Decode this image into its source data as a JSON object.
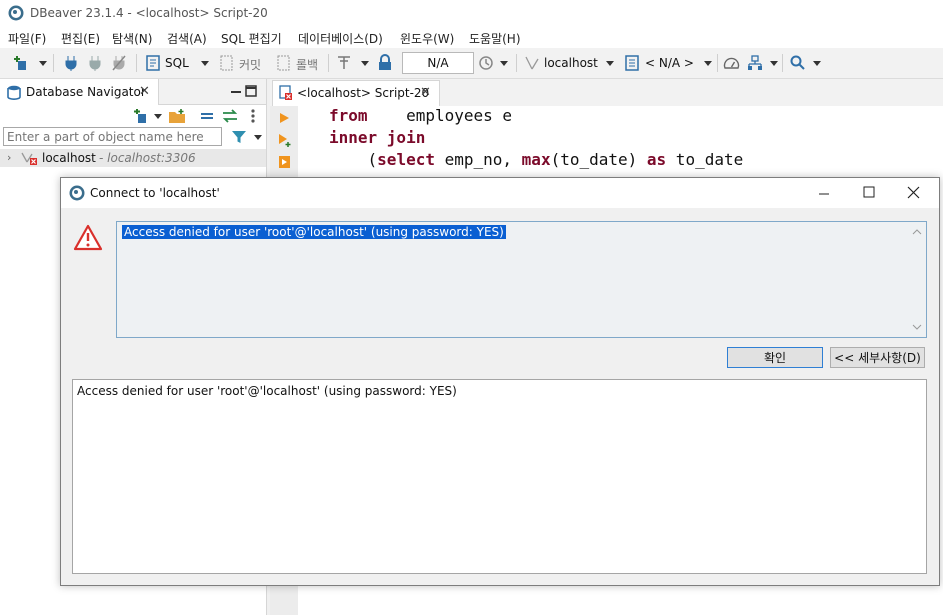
{
  "window": {
    "title": "DBeaver 23.1.4 - <localhost> Script-20"
  },
  "menu": [
    "파일(F)",
    "편집(E)",
    "탐색(N)",
    "검색(A)",
    "SQL 편집기",
    "데이터베이스(D)",
    "윈도우(W)",
    "도움말(H)"
  ],
  "toolbar": {
    "sql_label": "SQL",
    "commit_label": "커밋",
    "rollback_label": "롤백",
    "transaction_value": "N/A",
    "connection_label": "localhost",
    "schema_label": "< N/A >"
  },
  "navigator": {
    "tab_label": "Database Navigator",
    "filter_placeholder": "Enter a part of object name here",
    "tree": [
      {
        "label": "localhost",
        "detail": "- localhost:3306"
      }
    ]
  },
  "editor": {
    "tab_label": "<localhost> Script-20",
    "lines": [
      {
        "kw1": "from",
        "rest": "    employees e"
      },
      {
        "kw1": "inner join",
        "rest": ""
      },
      {
        "indent": "    (",
        "kw1": "select",
        "mid": " emp_no, ",
        "kw2": "max",
        "mid2": "(to_date) ",
        "kw3": "as",
        "tail": " to_date"
      }
    ]
  },
  "dialog": {
    "title": "Connect to 'localhost'",
    "message": "Access denied for user 'root'@'localhost' (using password: YES)",
    "ok_label": "확인",
    "details_label": "<< 세부사항(D)",
    "details_text": "Access denied for user 'root'@'localhost' (using password: YES)"
  },
  "colors": {
    "accent": "#0a5fd2",
    "keyword": "#7b0a2a",
    "error": "#d9302c"
  }
}
